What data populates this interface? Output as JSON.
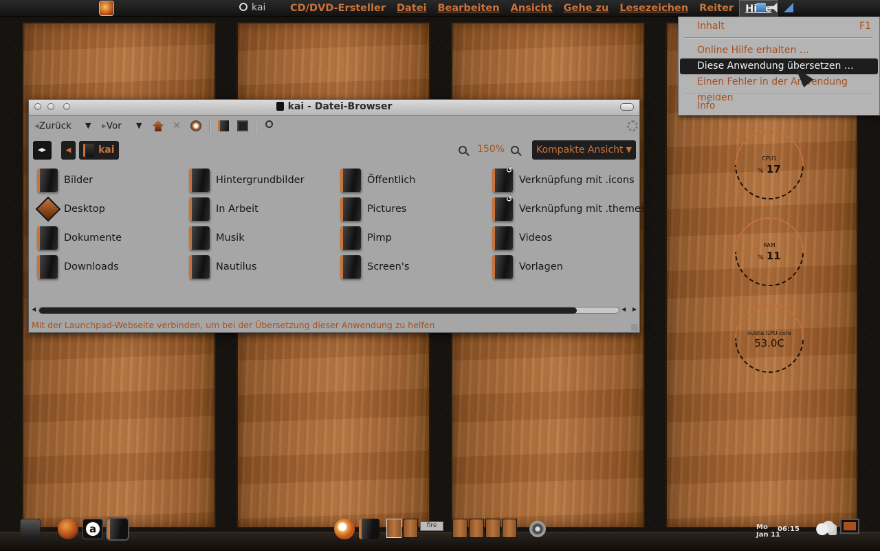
{
  "top_panel": {
    "user": "kai",
    "menus": [
      "CD/DVD-Ersteller",
      "Datei",
      "Bearbeiten",
      "Ansicht",
      "Gehe zu",
      "Lesezeichen",
      "Reiter",
      "Hilfe"
    ],
    "active_menu": "Hilfe"
  },
  "help_menu": {
    "items": [
      {
        "label": "Inhalt",
        "accel": "F1"
      },
      {
        "label": "Online Hilfe erhalten …"
      },
      {
        "label": "Diese Anwendung übersetzen …",
        "selected": true
      },
      {
        "label": "Einen Fehler in der Anwendung melden"
      },
      {
        "label": "Info"
      }
    ]
  },
  "gauges": [
    {
      "label": "CPU1",
      "unit": "%",
      "value": "17"
    },
    {
      "label": "RAM",
      "unit": "%",
      "value": "11"
    },
    {
      "label": "nvidia GPU-core",
      "value": "53.0C"
    }
  ],
  "window": {
    "title": "kai - Datei-Browser",
    "toolbar": {
      "back": "Zurück",
      "forward": "Vor"
    },
    "location": {
      "crumb": "kai",
      "zoom": "150%",
      "view": "Kompakte Ansicht"
    },
    "files": [
      {
        "name": "Bilder"
      },
      {
        "name": "Hintergrundbilder"
      },
      {
        "name": "Öffentlich"
      },
      {
        "name": "Verknüpfung mit .icons",
        "link": true
      },
      {
        "name": "Desktop"
      },
      {
        "name": "In Arbeit"
      },
      {
        "name": "Pictures"
      },
      {
        "name": "Verknüpfung mit .themes",
        "link": true
      },
      {
        "name": "Dokumente"
      },
      {
        "name": "Musik"
      },
      {
        "name": "Pimp"
      },
      {
        "name": "Videos"
      },
      {
        "name": "Downloads"
      },
      {
        "name": "Nautilus"
      },
      {
        "name": "Screen's"
      },
      {
        "name": "Vorlagen"
      }
    ],
    "status": "Mit der Launchpad-Webseite verbinden, um bei der Übersetzung dieser Anwendung zu helfen"
  },
  "dock": {
    "pager_label": "fire",
    "clock_day": "Mo",
    "clock_date": "Jan 11",
    "clock_time": "06:15"
  },
  "colors": {
    "accent": "#c8733a",
    "menu_text": "#a8501b",
    "window_bg": "#a6a6a6"
  }
}
